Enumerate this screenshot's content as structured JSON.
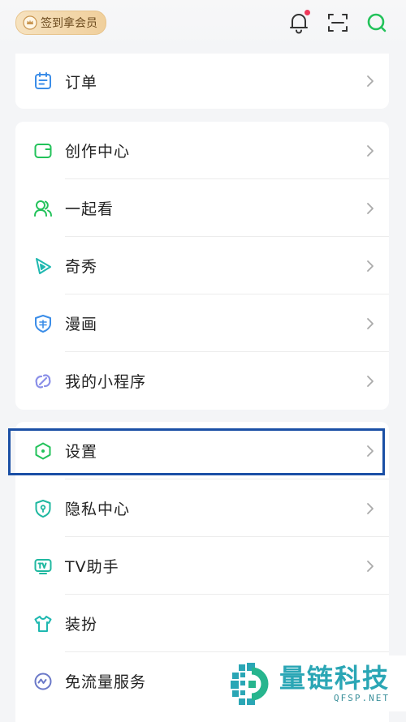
{
  "topbar": {
    "signin_label": "签到拿会员",
    "icons": [
      "bell-icon",
      "scan-icon",
      "search-icon"
    ]
  },
  "card_top": {
    "items": [
      {
        "label": "订单",
        "icon": "order-icon"
      }
    ]
  },
  "card_main": {
    "items": [
      {
        "label": "创作中心",
        "icon": "creation-icon"
      },
      {
        "label": "一起看",
        "icon": "watch-together-icon"
      },
      {
        "label": "奇秀",
        "icon": "qixiu-icon"
      },
      {
        "label": "漫画",
        "icon": "comic-icon"
      },
      {
        "label": "我的小程序",
        "icon": "mini-program-icon"
      }
    ]
  },
  "card_settings": {
    "items": [
      {
        "label": "设置",
        "icon": "settings-icon"
      },
      {
        "label": "隐私中心",
        "icon": "privacy-icon"
      },
      {
        "label": "TV助手",
        "icon": "tv-icon"
      },
      {
        "label": "装扮",
        "icon": "dressup-icon"
      },
      {
        "label": "免流量服务",
        "icon": "data-free-icon"
      }
    ]
  },
  "watermark": {
    "title": "量链科技",
    "subtitle": "QFSP.NET"
  },
  "colors": {
    "accent_green": "#22c25a",
    "highlight_blue": "#1a4fa5",
    "notification_red": "#f0385a"
  }
}
